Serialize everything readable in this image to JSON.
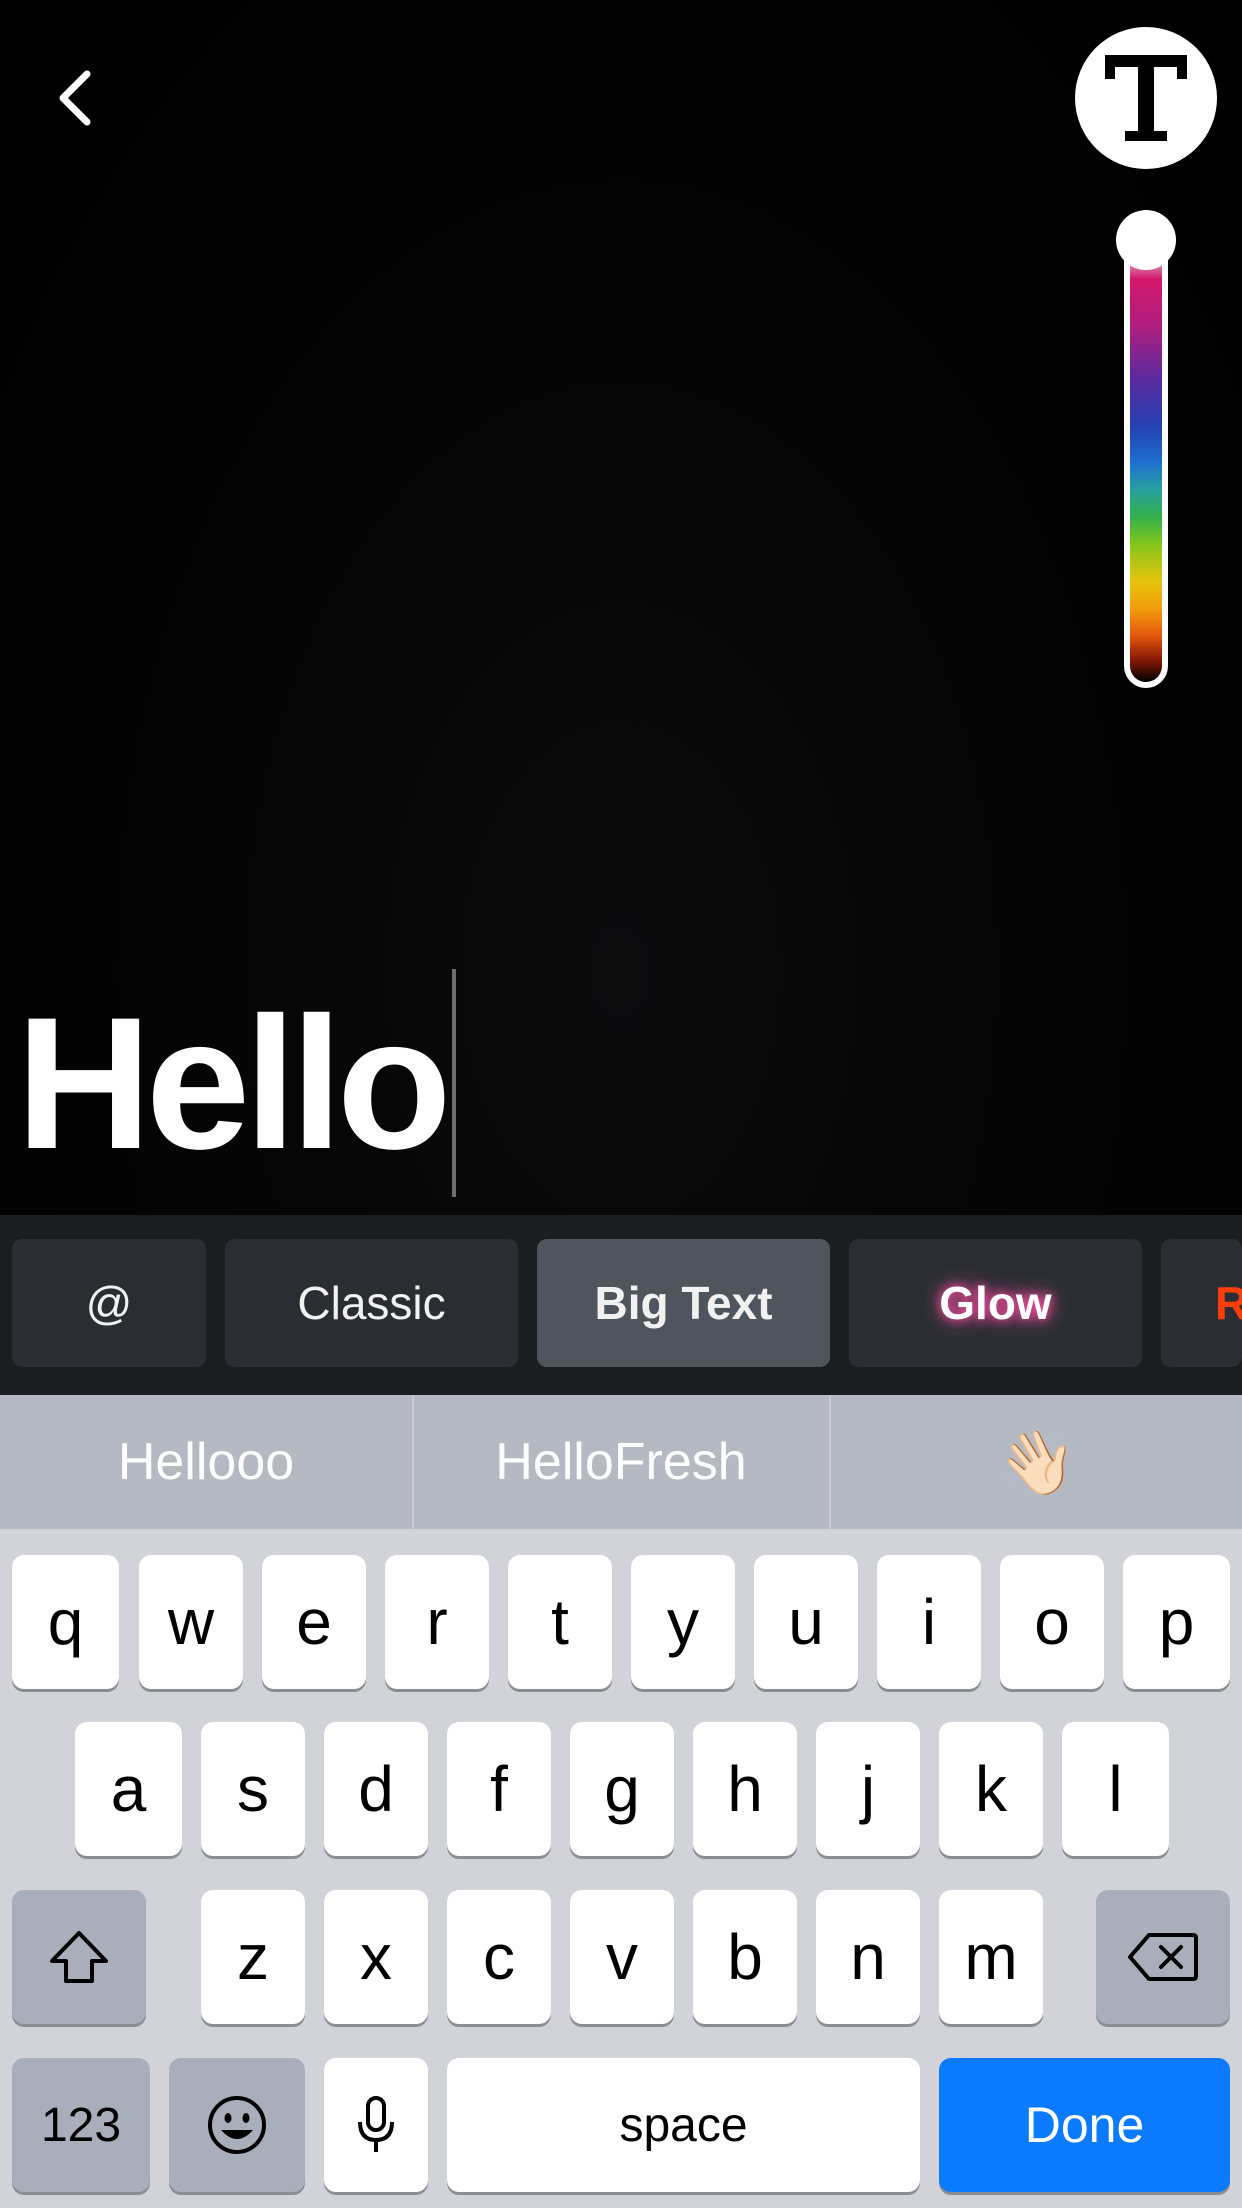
{
  "editor": {
    "text_value": "Hello",
    "back_icon": "chevron-left-icon",
    "text_tool_icon": "text-style-T-icon",
    "color_slider_level": 0.0
  },
  "styles": {
    "chips": [
      {
        "label": "@"
      },
      {
        "label": "Classic"
      },
      {
        "label": "Big Text"
      },
      {
        "label": "Glow"
      },
      {
        "label": "R"
      }
    ],
    "selected": "Big Text"
  },
  "keyboard": {
    "suggestions": [
      "Hellooo",
      "HelloFresh",
      "👋🏻"
    ],
    "row1": [
      "q",
      "w",
      "e",
      "r",
      "t",
      "y",
      "u",
      "i",
      "o",
      "p"
    ],
    "row2": [
      "a",
      "s",
      "d",
      "f",
      "g",
      "h",
      "j",
      "k",
      "l"
    ],
    "row3": [
      "z",
      "x",
      "c",
      "v",
      "b",
      "n",
      "m"
    ],
    "numbers_label": "123",
    "space_label": "space",
    "done_label": "Done",
    "done_color": "#0a7aff"
  }
}
